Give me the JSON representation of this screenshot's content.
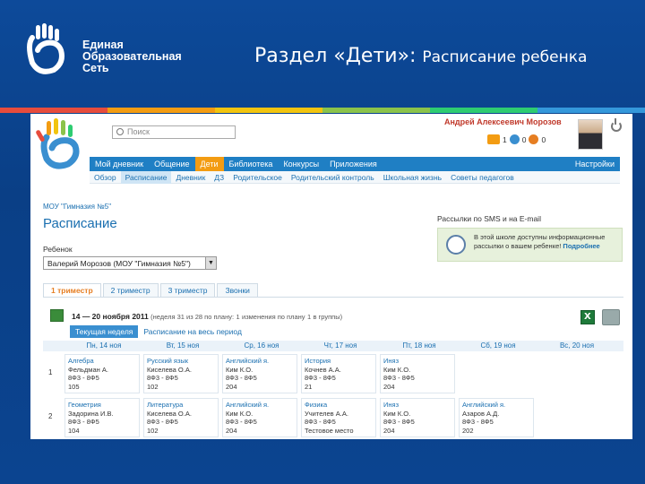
{
  "slide": {
    "brand": [
      "Единая",
      "Образовательная",
      "Сеть"
    ],
    "title": "Раздел «Дети»:",
    "subtitle": "Расписание ребенка"
  },
  "search": {
    "placeholder": "Поиск"
  },
  "user": {
    "name": "Андрей Алексеевич Морозов"
  },
  "counters": [
    "1",
    "0",
    "0"
  ],
  "topnav": {
    "items": [
      "Мой дневник",
      "Общение",
      "Дети",
      "Библиотека",
      "Конкурсы",
      "Приложения"
    ],
    "active": "Дети",
    "settings": "Настройки"
  },
  "subnav": {
    "items": [
      "Обзор",
      "Расписание",
      "Дневник",
      "ДЗ",
      "Родительское",
      "Родительский контроль",
      "Школьная жизнь",
      "Советы педагогов"
    ],
    "active": "Расписание"
  },
  "breadcrumb": "МОУ \"Гимназия №5\"",
  "page_title": "Расписание",
  "child": {
    "label": "Ребенок",
    "value": "Валерий Морозов (МОУ \"Гимназия №5\")"
  },
  "sms": {
    "title": "Рассылки по SMS и на E-mail",
    "text": "В этой школе доступны информационные рассылки о вашем ребенке!",
    "link": "Подробнее"
  },
  "tabs": [
    "1 триместр",
    "2 триместр",
    "3 триместр",
    "Звонки"
  ],
  "week": {
    "range": "14 — 20 ноября 2011",
    "info_before": "(неделя 31 из 28 по плану:",
    "info_count": "1",
    "info_mid": "изменения по плану",
    "info_count2": "1",
    "info_end": "в группы)"
  },
  "period_buttons": [
    "Текущая неделя",
    "Расписание на весь период"
  ],
  "days": [
    "Пн, 14 ноя",
    "Вт, 15 ноя",
    "Ср, 16 ноя",
    "Чт, 17 ноя",
    "Пт, 18 ноя",
    "Сб, 19 ноя",
    "Вс, 20 ноя"
  ],
  "schedule": [
    {
      "num": "1",
      "cells": [
        [
          "Алгебра",
          "Фельдман А.",
          "8Ф3 - 8Ф5",
          "105"
        ],
        [
          "Русский язык",
          "Киселева О.А.",
          "8Ф3 - 8Ф5",
          "102"
        ],
        [
          "Английский я.",
          "Ким К.О.",
          "8Ф3 - 8Ф5",
          "204"
        ],
        [
          "История",
          "Кочнев А.А.",
          "8Ф3 - 8Ф5",
          "21"
        ],
        [
          "Иняз",
          "Ким К.О.",
          "8Ф3 - 8Ф5",
          "204"
        ],
        null,
        null
      ]
    },
    {
      "num": "2",
      "cells": [
        [
          "Геометрия",
          "Задорина И.В.",
          "8Ф3 - 8Ф5",
          "104"
        ],
        [
          "Литература",
          "Киселева О.А.",
          "8Ф3 - 8Ф5",
          "102"
        ],
        [
          "Английский я.",
          "Ким К.О.",
          "8Ф3 - 8Ф5",
          "204"
        ],
        [
          "Физика",
          "Учителев А.А.",
          "8Ф3 - 8Ф5",
          "Тестовое место"
        ],
        [
          "Иняз",
          "Ким К.О.",
          "8Ф3 - 8Ф5",
          "204"
        ],
        [
          "Английский я.",
          "Азаров А.Д.",
          "8Ф3 - 8Ф5",
          "202"
        ],
        null
      ]
    }
  ],
  "colors": {
    "slide_bg": "#0a3f86",
    "nav_blue": "#1f7fc4",
    "accent_orange": "#f39c12",
    "link_blue": "#1a6fb0",
    "user_red": "#c0392b"
  }
}
